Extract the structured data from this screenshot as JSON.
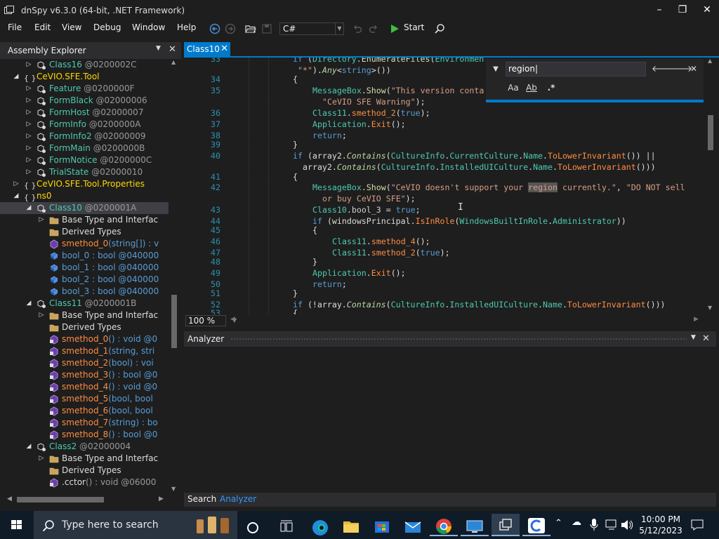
{
  "window": {
    "title": "dnSpy v6.3.0 (64-bit, .NET Framework)",
    "minimize": "–",
    "maximize": "❐",
    "close": "✕"
  },
  "menu": [
    "File",
    "Edit",
    "View",
    "Debug",
    "Window",
    "Help"
  ],
  "toolbar": {
    "language": "C#",
    "start_label": "Start"
  },
  "explorer": {
    "title": "Assembly Explorer",
    "tree": [
      {
        "indent": 4,
        "arrow": "▷",
        "icon": "class",
        "name": "Class16",
        "token": " @0200002C",
        "cls": "c-type"
      },
      {
        "indent": 3,
        "arrow": "◢",
        "icon": "ns",
        "name": "CeVIO.SFE.Tool",
        "token": "",
        "cls": "c-ns"
      },
      {
        "indent": 4,
        "arrow": "▷",
        "icon": "class",
        "name": "Feature",
        "token": " @0200000F",
        "cls": "c-type"
      },
      {
        "indent": 4,
        "arrow": "▷",
        "icon": "class",
        "name": "FormBlack",
        "token": " @02000006",
        "cls": "c-type"
      },
      {
        "indent": 4,
        "arrow": "▷",
        "icon": "class",
        "name": "FormHost",
        "token": " @02000007",
        "cls": "c-type"
      },
      {
        "indent": 4,
        "arrow": "▷",
        "icon": "class",
        "name": "FormInfo",
        "token": " @0200000A",
        "cls": "c-type"
      },
      {
        "indent": 4,
        "arrow": "▷",
        "icon": "class",
        "name": "FormInfo2",
        "token": " @02000009",
        "cls": "c-type"
      },
      {
        "indent": 4,
        "arrow": "▷",
        "icon": "class",
        "name": "FormMain",
        "token": " @0200000B",
        "cls": "c-type"
      },
      {
        "indent": 4,
        "arrow": "▷",
        "icon": "class",
        "name": "FormNotice",
        "token": " @0200000C",
        "cls": "c-type"
      },
      {
        "indent": 4,
        "arrow": "▷",
        "icon": "class",
        "name": "TrialState",
        "token": " @02000010",
        "cls": "c-type"
      },
      {
        "indent": 3,
        "arrow": "▷",
        "icon": "ns",
        "name": "CeVIO.SFE.Tool.Properties",
        "token": "",
        "cls": "c-ns"
      },
      {
        "indent": 3,
        "arrow": "◢",
        "icon": "ns",
        "name": "ns0",
        "token": "",
        "cls": "c-ns"
      },
      {
        "indent": 4,
        "arrow": "◢",
        "icon": "class",
        "name": "Class10",
        "token": " @0200001A",
        "cls": "c-sel",
        "selected": true
      },
      {
        "indent": 5,
        "arrow": "▷",
        "icon": "folder",
        "name": "Base Type and Interfac",
        "token": "",
        "cls": "c-plain"
      },
      {
        "indent": 5,
        "arrow": "",
        "icon": "folder",
        "name": "Derived Types",
        "token": "",
        "cls": "c-plain"
      },
      {
        "indent": 5,
        "arrow": "",
        "icon": "method",
        "name": "smethod_0",
        "token": "(string[]) : v",
        "cls": "c-meth"
      },
      {
        "indent": 5,
        "arrow": "",
        "icon": "field",
        "name": "bool_0",
        "token": " : bool @040000",
        "cls": "c-fld"
      },
      {
        "indent": 5,
        "arrow": "",
        "icon": "field",
        "name": "bool_1",
        "token": " : bool @040000",
        "cls": "c-fld"
      },
      {
        "indent": 5,
        "arrow": "",
        "icon": "field",
        "name": "bool_2",
        "token": " : bool @040000",
        "cls": "c-fld"
      },
      {
        "indent": 5,
        "arrow": "",
        "icon": "field",
        "name": "bool_3",
        "token": " : bool @040000",
        "cls": "c-fld"
      },
      {
        "indent": 4,
        "arrow": "◢",
        "icon": "class",
        "name": "Class11",
        "token": " @0200001B",
        "cls": "c-type"
      },
      {
        "indent": 5,
        "arrow": "▷",
        "icon": "folder",
        "name": "Base Type and Interfac",
        "token": "",
        "cls": "c-plain"
      },
      {
        "indent": 5,
        "arrow": "",
        "icon": "folder",
        "name": "Derived Types",
        "token": "",
        "cls": "c-plain"
      },
      {
        "indent": 5,
        "arrow": "",
        "icon": "method-lock",
        "name": "smethod_0",
        "token": "() : void @0",
        "cls": "c-meth"
      },
      {
        "indent": 5,
        "arrow": "",
        "icon": "method-lock",
        "name": "smethod_1",
        "token": "(string, stri",
        "cls": "c-meth"
      },
      {
        "indent": 5,
        "arrow": "",
        "icon": "method-lock",
        "name": "smethod_2",
        "token": "(bool) : voi",
        "cls": "c-meth"
      },
      {
        "indent": 5,
        "arrow": "",
        "icon": "method-lock",
        "name": "smethod_3",
        "token": "() : bool @0",
        "cls": "c-meth"
      },
      {
        "indent": 5,
        "arrow": "",
        "icon": "method-lock",
        "name": "smethod_4",
        "token": "() : void @0",
        "cls": "c-meth"
      },
      {
        "indent": 5,
        "arrow": "",
        "icon": "method-lock",
        "name": "smethod_5",
        "token": "(bool, bool",
        "cls": "c-meth"
      },
      {
        "indent": 5,
        "arrow": "",
        "icon": "method-lock",
        "name": "smethod_6",
        "token": "(bool, bool",
        "cls": "c-meth"
      },
      {
        "indent": 5,
        "arrow": "",
        "icon": "method-lock",
        "name": "smethod_7",
        "token": "(string) : bo",
        "cls": "c-meth"
      },
      {
        "indent": 5,
        "arrow": "",
        "icon": "method-lock",
        "name": "smethod_8",
        "token": "() : bool @0",
        "cls": "c-meth"
      },
      {
        "indent": 4,
        "arrow": "◢",
        "icon": "class",
        "name": "Class2",
        "token": " @02000004",
        "cls": "c-type"
      },
      {
        "indent": 5,
        "arrow": "▷",
        "icon": "folder",
        "name": "Base Type and Interfac",
        "token": "",
        "cls": "c-plain"
      },
      {
        "indent": 5,
        "arrow": "",
        "icon": "folder",
        "name": "Derived Types",
        "token": "",
        "cls": "c-plain"
      },
      {
        "indent": 5,
        "arrow": "",
        "icon": "method-lock",
        "name": ".cctor",
        "token": "() : void @06000",
        "cls": "c-plain"
      }
    ]
  },
  "editor": {
    "tab": "Class10",
    "zoom": "100 %",
    "lines": [
      {
        "n": "33",
        "indent": 0,
        "html": "<span class='k'>if</span> (<span class='t'>Directory</span>.<span class='m'>EnumerateFiles</span>(<span class='t'>Environmen</span>"
      },
      {
        "n": "",
        "indent": 1,
        "html": "<span class='s'>\"*\"</span>).<span class='mi'>Any</span>&lt;<span class='k'>string</span>&gt;())"
      },
      {
        "n": "34",
        "indent": 0,
        "html": "{"
      },
      {
        "n": "35",
        "indent": 4,
        "html": "<span class='t'>MessageBox</span>.<span class='m'>Show</span>(<span class='s'>\"This version conta</span>"
      },
      {
        "n": "",
        "indent": 6,
        "html": "<span class='s'>\"CeVIO SFE Warning\"</span>);"
      },
      {
        "n": "36",
        "indent": 4,
        "html": "<span class='t'>Class11</span>.<span class='i'>smethod_2</span>(<span class='k'>true</span>);"
      },
      {
        "n": "37",
        "indent": 4,
        "html": "<span class='t'>Application</span>.<span class='i'>Exit</span>();"
      },
      {
        "n": "38",
        "indent": 4,
        "html": "<span class='k'>return</span>;"
      },
      {
        "n": "39",
        "indent": 0,
        "html": "}"
      },
      {
        "n": "40",
        "indent": 0,
        "html": "<span class='k'>if</span> (array2.<span class='mi'>Contains</span>(<span class='t'>CultureInfo</span>.<span class='t'>CurrentCulture</span>.<span class='t'>Name</span>.<span class='i'>ToLowerInvariant</span>()) ||"
      },
      {
        "n": "",
        "indent": 2,
        "html": "array2.<span class='mi'>Contains</span>(<span class='t'>CultureInfo</span>.<span class='t'>InstalledUICulture</span>.<span class='t'>Name</span>.<span class='i'>ToLowerInvariant</span>()))"
      },
      {
        "n": "41",
        "indent": 0,
        "html": "{"
      },
      {
        "n": "42",
        "indent": 4,
        "html": "<span class='t'>MessageBox</span>.<span class='m'>Show</span>(<span class='s'>\"CeVIO doesn't support your <span class='hl'>region</span> currently.\"</span>, <span class='s'>\"DO NOT sell</span>"
      },
      {
        "n": "",
        "indent": 6,
        "html": "<span class='s'>or buy CeVIO SFE\"</span>);"
      },
      {
        "n": "43",
        "indent": 4,
        "html": "<span class='t'>Class10</span>.<span class='f'>bool_3</span> = <span class='k'>true</span>;"
      },
      {
        "n": "44",
        "indent": 4,
        "html": "<span class='k'>if</span> (windowsPrincipal.<span class='i'>IsInRole</span>(<span class='t'>WindowsBuiltInRole</span>.<span class='t'>Administrator</span>))"
      },
      {
        "n": "45",
        "indent": 4,
        "html": "{"
      },
      {
        "n": "46",
        "indent": 8,
        "html": "<span class='t'>Class11</span>.<span class='i'>smethod_4</span>();"
      },
      {
        "n": "47",
        "indent": 8,
        "html": "<span class='t'>Class11</span>.<span class='i'>smethod_2</span>(<span class='k'>true</span>);"
      },
      {
        "n": "48",
        "indent": 4,
        "html": "}"
      },
      {
        "n": "49",
        "indent": 4,
        "html": "<span class='t'>Application</span>.<span class='i'>Exit</span>();"
      },
      {
        "n": "50",
        "indent": 4,
        "html": "<span class='k'>return</span>;"
      },
      {
        "n": "51",
        "indent": 0,
        "html": "}"
      },
      {
        "n": "52",
        "indent": 0,
        "html": "<span class='k'>if</span> (!array.<span class='mi'>Contains</span>(<span class='t'>CultureInfo</span>.<span class='t'>InstalledUICulture</span>.<span class='t'>Name</span>.<span class='i'>ToLowerInvariant</span>()))"
      },
      {
        "n": "53",
        "indent": 0,
        "html": "{"
      }
    ]
  },
  "find": {
    "query": "region",
    "case_label": "Aa",
    "word_label": "Ab",
    "regex_label": ".*"
  },
  "analyzer": {
    "title": "Analyzer"
  },
  "bottom_tabs": {
    "search": "Search",
    "analyzer": "Analyzer"
  },
  "taskbar": {
    "search_placeholder": "Type here to search",
    "time": "10:00 PM",
    "date": "5/12/2023"
  }
}
